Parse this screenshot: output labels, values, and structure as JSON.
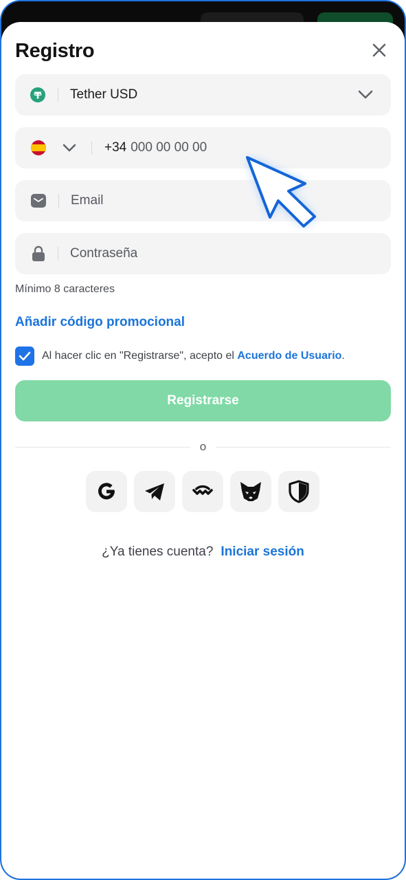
{
  "dialog": {
    "title": "Registro"
  },
  "currency": {
    "selected": "Tether USD",
    "icon": "tether-icon"
  },
  "phone": {
    "country_flag": "spain-flag-icon",
    "prefix": "+34",
    "placeholder": "000 00 00 00"
  },
  "email": {
    "placeholder": "Email",
    "icon": "mail-icon"
  },
  "password": {
    "placeholder": "Contraseña",
    "icon": "lock-icon",
    "hint": "Mínimo 8 caracteres"
  },
  "promo": {
    "label": "Añadir código promocional"
  },
  "agreement": {
    "checked": true,
    "text": "Al hacer clic en \"Registrarse\", acepto el ",
    "link": "Acuerdo de Usuario",
    "suffix": "."
  },
  "register": {
    "label": "Registrarse"
  },
  "separator": {
    "text": "o"
  },
  "social": [
    "google-icon",
    "telegram-icon",
    "walletconnect-icon",
    "metamask-fox-icon",
    "shield-icon"
  ],
  "login": {
    "question": "¿Ya tienes cuenta?",
    "link": "Iniciar sesión"
  },
  "colors": {
    "accent": "#1b74d8",
    "register_button": "#80d9a6",
    "field_bg": "#f4f4f5"
  }
}
